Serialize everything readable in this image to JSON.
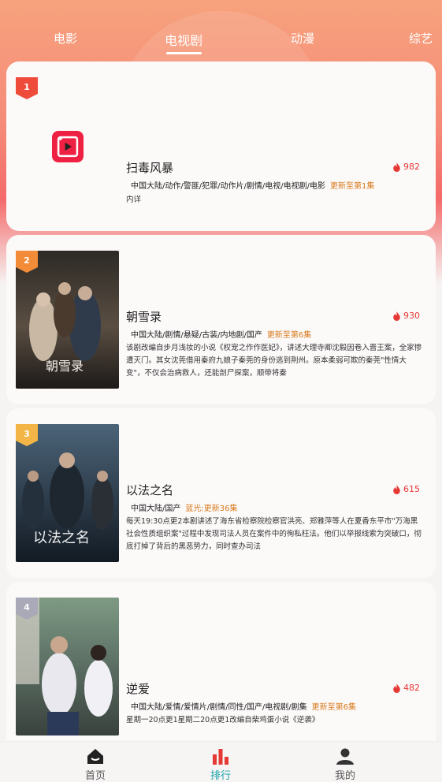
{
  "top_tabs": [
    "电影",
    "电视剧",
    "动漫",
    "综艺"
  ],
  "active_tab": "电视剧",
  "items": [
    {
      "rank": "1",
      "badge_color": "#ef4b3b",
      "title": "扫毒风暴",
      "heat": "982",
      "tags": "中国大陆/动作/警匪/犯罪/动作片/剧情/电视/电视剧/电影",
      "update": "更新至第1集",
      "desc": "内详",
      "poster": "app-logo"
    },
    {
      "rank": "2",
      "badge_color": "#f28c38",
      "title": "朝雪录",
      "heat": "930",
      "tags": "中国大陆/剧情/悬疑/古装/内地剧/国产",
      "update": "更新至第6集",
      "desc": "该剧改编自步月浅妆的小说《权宠之作作医妃》，讲述大理寺卿沈毅因卷入晋王案，全家惨遭灭门。其女沈莞借用秦府九娘子秦莞的身份逃到荆州。原本柔弱可欺的秦莞\"性情大变\"，不仅会治病救人，还能剖尸探案，顺带将秦",
      "poster": "poster-2"
    },
    {
      "rank": "3",
      "badge_color": "#f3b545",
      "title": "以法之名",
      "heat": "615",
      "tags": "中国大陆/国产",
      "update": "蓝光:更新36集",
      "desc": "每天19:30点更2本剧讲述了海东省检察院检察官洪亮、郑雅萍等人在夏香东平市\"万海黑社会性质组织案\"过程中发现司法人员在案件中的徇私枉法。他们以举报线索为突破口，彻底打掉了背后的黑恶势力，同时查办司法",
      "poster": "poster-3"
    },
    {
      "rank": "4",
      "badge_color": "#a9a9b8",
      "title": "逆爱",
      "heat": "482",
      "tags": "中国大陆/爱情/爱情片/剧情/同性/国产/电视剧/剧集",
      "update": "更新至第6集",
      "desc": "星期一20点更1星期二20点更1改编自柴鸡蛋小说《逆袭》",
      "poster": "poster-4"
    }
  ],
  "bottom_nav": {
    "home": "首页",
    "rank": "排行",
    "mine": "我的"
  },
  "colors": {
    "heat": "#e53935",
    "update": "#d87a1b",
    "nav_active": "#16a2a8",
    "nav_icon_active": "#e53935"
  }
}
